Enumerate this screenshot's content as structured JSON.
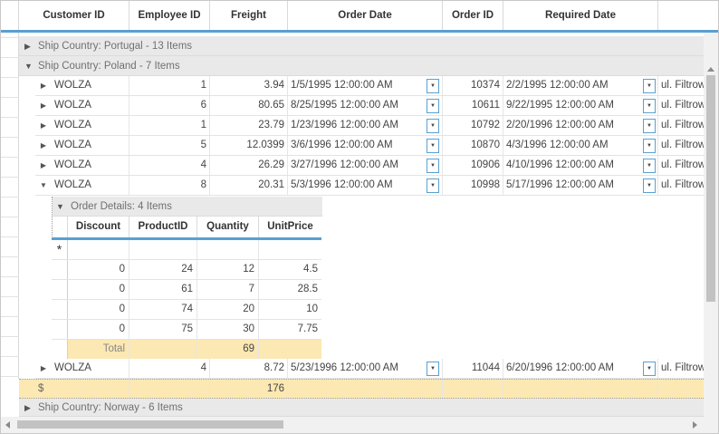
{
  "columns": [
    "Customer ID",
    "Employee ID",
    "Freight",
    "Order Date",
    "Order ID",
    "Required Date"
  ],
  "groups": {
    "portugal": "Ship Country: Portugal - 13 Items",
    "poland": "Ship Country: Poland - 7 Items",
    "norway": "Ship Country: Norway - 6 Items"
  },
  "rows": [
    {
      "customer": "WOLZA",
      "employee": "1",
      "freight": "3.94",
      "order_date": "1/5/1995 12:00:00 AM",
      "order_id": "10374",
      "required_date": "2/2/1995 12:00:00 AM",
      "ship_address": "ul. Filtrow"
    },
    {
      "customer": "WOLZA",
      "employee": "6",
      "freight": "80.65",
      "order_date": "8/25/1995 12:00:00 AM",
      "order_id": "10611",
      "required_date": "9/22/1995 12:00:00 AM",
      "ship_address": "ul. Filtrow"
    },
    {
      "customer": "WOLZA",
      "employee": "1",
      "freight": "23.79",
      "order_date": "1/23/1996 12:00:00 AM",
      "order_id": "10792",
      "required_date": "2/20/1996 12:00:00 AM",
      "ship_address": "ul. Filtrow"
    },
    {
      "customer": "WOLZA",
      "employee": "5",
      "freight": "12.0399",
      "order_date": "3/6/1996 12:00:00 AM",
      "order_id": "10870",
      "required_date": "4/3/1996 12:00:00 AM",
      "ship_address": "ul. Filtrow"
    },
    {
      "customer": "WOLZA",
      "employee": "4",
      "freight": "26.29",
      "order_date": "3/27/1996 12:00:00 AM",
      "order_id": "10906",
      "required_date": "4/10/1996 12:00:00 AM",
      "ship_address": "ul. Filtrow"
    },
    {
      "customer": "WOLZA",
      "employee": "8",
      "freight": "20.31",
      "order_date": "5/3/1996 12:00:00 AM",
      "order_id": "10998",
      "required_date": "5/17/1996 12:00:00 AM",
      "ship_address": "ul. Filtrow"
    },
    {
      "customer": "WOLZA",
      "employee": "4",
      "freight": "8.72",
      "order_date": "5/23/1996 12:00:00 AM",
      "order_id": "11044",
      "required_date": "6/20/1996 12:00:00 AM",
      "ship_address": "ul. Filtrow"
    }
  ],
  "child": {
    "group_label": "Order Details: 4 Items",
    "new_row_marker": "*",
    "columns": [
      "Discount",
      "ProductID",
      "Quantity",
      "UnitPrice"
    ],
    "rows": [
      {
        "discount": "0",
        "product": "24",
        "quantity": "12",
        "price": "4.5"
      },
      {
        "discount": "0",
        "product": "61",
        "quantity": "7",
        "price": "28.5"
      },
      {
        "discount": "0",
        "product": "74",
        "quantity": "20",
        "price": "10"
      },
      {
        "discount": "0",
        "product": "75",
        "quantity": "30",
        "price": "7.75"
      }
    ],
    "summary_label": "Total",
    "summary_quantity": "69"
  },
  "group_summary": {
    "label": "$",
    "freight_total": "176"
  },
  "icons": {
    "collapsed": "triangle-right-icon",
    "expanded": "triangle-down-icon",
    "dropdown": "chevron-down-icon",
    "new_row": "asterisk-icon"
  },
  "colors": {
    "header_accent": "#5aa0d2",
    "summary_bg": "#fce8b2",
    "group_bg": "#e9e9e9"
  }
}
